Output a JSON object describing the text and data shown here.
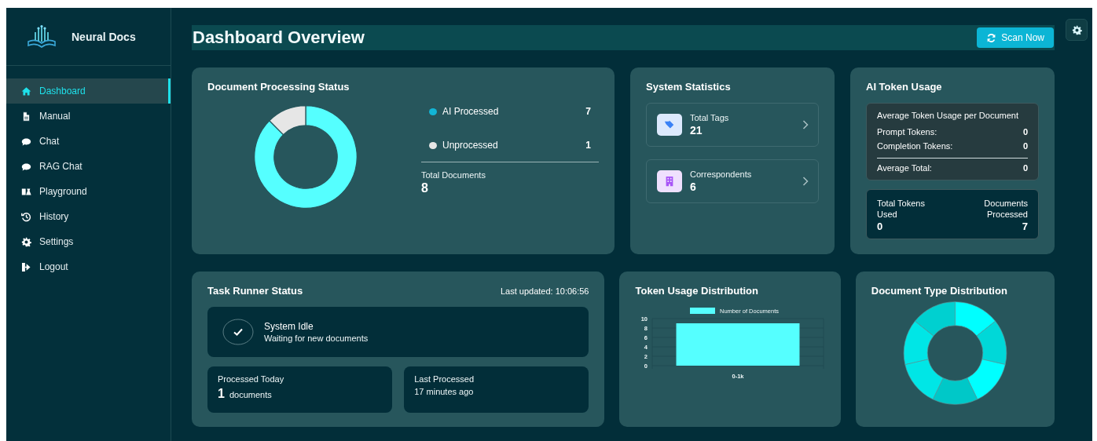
{
  "sidebar": {
    "brand": "Neural Docs",
    "items": [
      {
        "label": "Dashboard",
        "selected": true
      },
      {
        "label": "Manual",
        "selected": false
      },
      {
        "label": "Chat",
        "selected": false
      },
      {
        "label": "RAG Chat",
        "selected": false
      },
      {
        "label": "Playground",
        "selected": false
      },
      {
        "label": "History",
        "selected": false
      },
      {
        "label": "Settings",
        "selected": false
      },
      {
        "label": "Logout",
        "selected": false
      }
    ]
  },
  "header": {
    "title": "Dashboard Overview",
    "scan_button": "Scan Now"
  },
  "processing": {
    "title": "Document Processing Status",
    "legend": [
      {
        "value": "7",
        "color": "#12b5d6"
      },
      {
        "value": "1",
        "color": "#e6e6e6"
      }
    ],
    "total_label": "Total Documents",
    "total_value": "8",
    "chart_data": {
      "type": "donut",
      "categories": [
        "AI Processed",
        "Unprocessed"
      ],
      "values": [
        87.5,
        12.5
      ]
    }
  },
  "system_statistics": {
    "title": "System Statistics",
    "items": [
      {
        "label": "Total Tags",
        "value": "21",
        "color": "#3b82f6"
      },
      {
        "label": "Correspondents",
        "value": "6",
        "color": "#a855f7"
      }
    ]
  },
  "token_usage": {
    "title": "AI Token Usage",
    "average_heading": "Average Token Usage per Document",
    "rows": [
      {
        "label": "Prompt Tokens:",
        "value": "0"
      },
      {
        "label": "Completion Tokens:",
        "value": "0"
      }
    ],
    "average_total": {
      "label": "Average Total:",
      "value": "0"
    },
    "total_tokens_label": "Total Tokens Used",
    "total_tokens_value": "0",
    "documents_processed_label": "Documents Processed",
    "documents_processed_value": "7"
  },
  "task_runner": {
    "title": "Task Runner Status",
    "last_updated": "Last updated: 10:06:56",
    "status_title": "System Idle",
    "status_text": "Waiting for new documents",
    "processed_today_label": "Processed Today",
    "processed_today_value": "1",
    "processed_today_unit": "documents",
    "last_processed_label": "Last Processed",
    "last_processed_value": "17 minutes ago"
  },
  "token_distribution": {
    "title": "Token Usage Distribution",
    "chart_data": {
      "type": "bar",
      "categories": [
        "0-1k"
      ],
      "series": [
        {
          "name": "Number of Documents",
          "color": "#55ffff",
          "values": [
            9
          ]
        }
      ],
      "ylim": [
        0,
        10
      ],
      "yticks": [
        0,
        2,
        4,
        6,
        8,
        10
      ],
      "grid": true
    }
  },
  "document_types": {
    "title": "Document Type Distribution",
    "kind": "picture"
  }
}
